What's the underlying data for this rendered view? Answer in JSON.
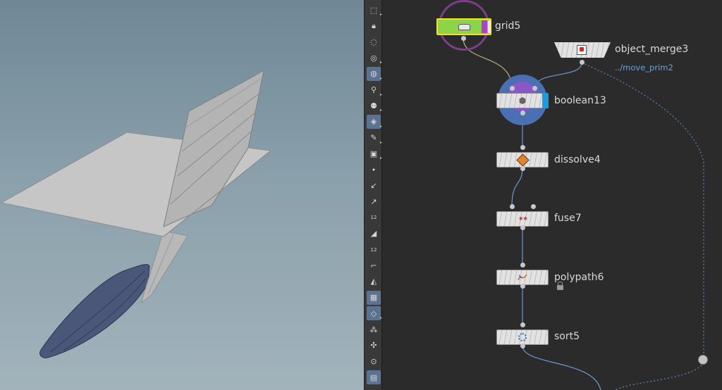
{
  "viewport": {
    "background_top": "#6f8796",
    "background_bottom": "#a2b3bb",
    "geometry_color": "#c9c9c9",
    "selected_color": "#4d5a7c"
  },
  "toolbar": {
    "tools": [
      {
        "icon": "select-icon"
      },
      {
        "icon": "lock-icon"
      },
      {
        "icon": "ghost-icon"
      },
      {
        "icon": "camera-icon"
      },
      {
        "icon": "light-icon"
      },
      {
        "icon": "light-bulb-icon"
      },
      {
        "icon": "geo-light-icon"
      },
      {
        "icon": "shading-icon"
      },
      {
        "icon": "paint-icon"
      },
      {
        "icon": "template-icon"
      },
      {
        "icon": "point-icon"
      },
      {
        "icon": "normal-icon"
      },
      {
        "icon": "vertex-normal-icon"
      },
      {
        "icon": "point-number-icon",
        "text": "12"
      },
      {
        "icon": "prim-normal-icon"
      },
      {
        "icon": "prim-number-icon",
        "text": "12"
      },
      {
        "icon": "corner-icon"
      },
      {
        "icon": "surface-icon"
      },
      {
        "icon": "checker-icon"
      },
      {
        "icon": "uv-icon"
      },
      {
        "icon": "group-icon"
      },
      {
        "icon": "axis-icon"
      },
      {
        "icon": "snap-icon"
      },
      {
        "icon": "display-icon"
      }
    ]
  },
  "network": {
    "nodes": [
      {
        "id": "grid5",
        "label": "grid5",
        "icon": "grid-icon"
      },
      {
        "id": "object_merge3",
        "label": "object_merge3",
        "sublabel": "../move_prim2",
        "icon": "object-merge-icon"
      },
      {
        "id": "boolean13",
        "label": "boolean13",
        "icon": "boolean-icon"
      },
      {
        "id": "dissolve4",
        "label": "dissolve4",
        "icon": "dissolve-icon"
      },
      {
        "id": "fuse7",
        "label": "fuse7",
        "icon": "fuse-icon"
      },
      {
        "id": "polypath6",
        "label": "polypath6",
        "icon": "polypath-icon",
        "locked": true
      },
      {
        "id": "sort5",
        "label": "sort5",
        "icon": "sort-icon"
      }
    ],
    "colors": {
      "grid_fill": "#8dd44a",
      "grid_flag": "#b040c8",
      "grid_border": "#f2e21a",
      "template_ring": "#7b3f86",
      "display_ring": "#4a6fb3",
      "boolean_badge": "#8b57c7",
      "display_flag": "#1e9ae0",
      "wire_gray": "#9a9a9a",
      "wire_blue": "#6c9ad0",
      "wire_dotted": "#5a87c4"
    }
  }
}
